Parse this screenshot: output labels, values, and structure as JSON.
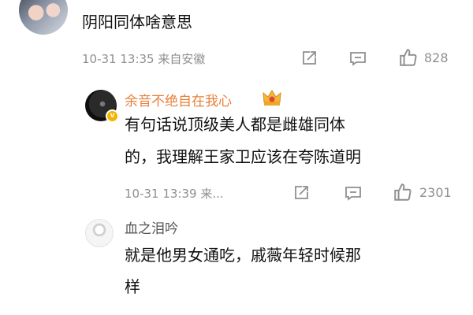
{
  "comment": {
    "text": "阴阳同体啥意思",
    "meta": "10-31 13:35 来自安徽",
    "likes": "828"
  },
  "replies": [
    {
      "username": "余音不绝自在我心",
      "text_line1": "有句话说顶级美人都是雌雄同体",
      "text_line2": "的，我理解王家卫应该在夸陈道明",
      "meta": "10-31 13:39 来...",
      "likes": "2301",
      "badge": "crown-badge-icon"
    },
    {
      "username": "血之泪吟",
      "text_line1": "就是他男女通吃，戚薇年轻时候那",
      "text_line2": "样"
    }
  ],
  "colors": {
    "username_accent": "#e87f3a",
    "meta": "#8f8f8f"
  }
}
